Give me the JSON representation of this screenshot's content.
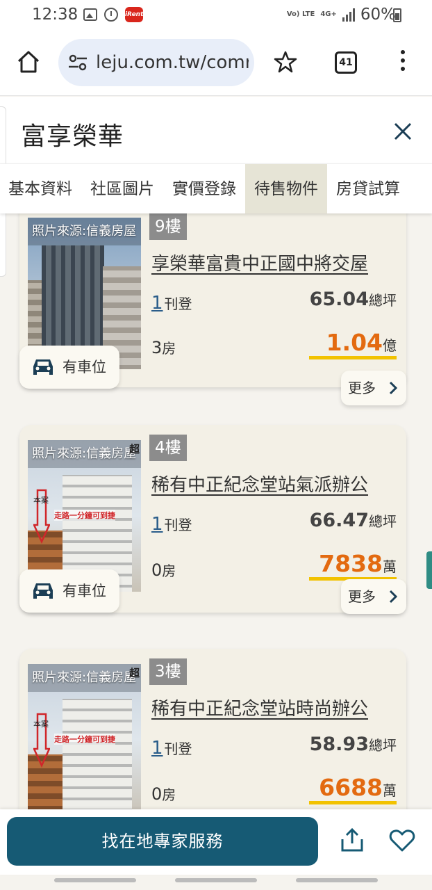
{
  "status_bar": {
    "time": "12:38",
    "network": "4G+",
    "volte": "Vo) LTE",
    "battery": "60%",
    "app_badge": "iRent"
  },
  "browser": {
    "url": "leju.com.tw/comr",
    "tab_count": "41"
  },
  "page": {
    "title": "富享榮華"
  },
  "tabs": [
    {
      "label": "基本資料"
    },
    {
      "label": "社區圖片"
    },
    {
      "label": "實價登錄"
    },
    {
      "label": "待售物件",
      "active": true
    },
    {
      "label": "房貸試算"
    }
  ],
  "listings": [
    {
      "photo_source": "照片來源:信義房屋",
      "parking": "有車位",
      "floor": "9樓",
      "name": "享榮華富貴中正國中將交屋",
      "listing_count": "1",
      "listing_label": "刊登",
      "area_value": "65.04",
      "area_unit": "總坪",
      "rooms_value": "3",
      "rooms_label": "房",
      "price_value": "1.04",
      "price_unit": "億",
      "more": "更多"
    },
    {
      "photo_source": "照片來源:信義房屋",
      "photo_corner": "超",
      "photo_tag": "本案",
      "photo_promo": "走路一分鐘可到捷",
      "parking": "有車位",
      "floor": "4樓",
      "name": "稀有中正紀念堂站氣派辦公",
      "listing_count": "1",
      "listing_label": "刊登",
      "area_value": "66.47",
      "area_unit": "總坪",
      "rooms_value": "0",
      "rooms_label": "房",
      "price_value": "7838",
      "price_unit": "萬",
      "more": "更多"
    },
    {
      "photo_source": "照片來源:信義房屋",
      "photo_corner": "超",
      "photo_tag": "本案",
      "photo_promo": "走路一分鐘可到捷",
      "floor": "3樓",
      "name": "稀有中正紀念堂站時尚辦公",
      "listing_count": "1",
      "listing_label": "刊登",
      "area_value": "58.93",
      "area_unit": "總坪",
      "rooms_value": "0",
      "rooms_label": "房",
      "price_value": "6688",
      "price_unit": "萬"
    }
  ],
  "bottom_bar": {
    "expert_button": "找在地專家服務"
  },
  "colors": {
    "brand": "#165a74",
    "price": "#e36a10",
    "price_underline": "#f2c200",
    "active_tab": "#e6e4d6",
    "card_bg": "#f3f0e6"
  }
}
